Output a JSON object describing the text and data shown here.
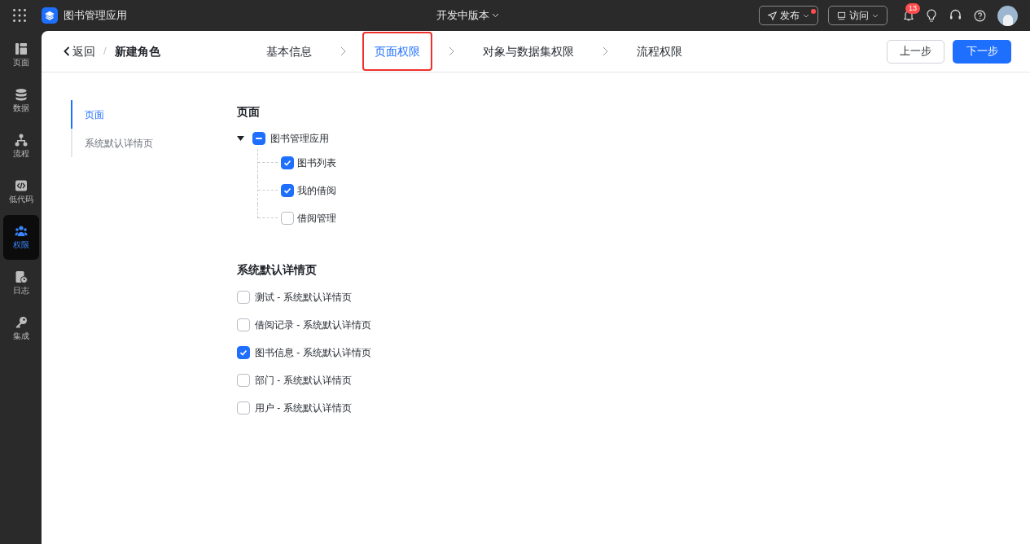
{
  "topbar": {
    "app_name": "图书管理应用",
    "version": "开发中版本",
    "publish": {
      "label": "发布",
      "dot": true
    },
    "visit": {
      "label": "访问"
    },
    "notifications": "13"
  },
  "rail": [
    {
      "label": "页面",
      "kind": "layout",
      "selected": false
    },
    {
      "label": "数据",
      "kind": "database",
      "selected": false
    },
    {
      "label": "流程",
      "kind": "flow",
      "selected": false
    },
    {
      "label": "低代码",
      "kind": "code",
      "selected": false
    },
    {
      "label": "权限",
      "kind": "users",
      "selected": true
    },
    {
      "label": "日志",
      "kind": "log",
      "selected": false
    },
    {
      "label": "集成",
      "kind": "key",
      "selected": false
    }
  ],
  "breadcrumb": {
    "back": "返回",
    "separator": "/",
    "current": "新建角色"
  },
  "steps": [
    {
      "label": "基本信息",
      "selected": false,
      "highlighted": false
    },
    {
      "label": "页面权限",
      "selected": true,
      "highlighted": true
    },
    {
      "label": "对象与数据集权限",
      "selected": false,
      "highlighted": false
    },
    {
      "label": "流程权限",
      "selected": false,
      "highlighted": false
    }
  ],
  "buttons": {
    "prev": "上一步",
    "next": "下一步"
  },
  "anchors": [
    {
      "label": "页面",
      "selected": true
    },
    {
      "label": "系统默认详情页",
      "selected": false
    }
  ],
  "pages_section": {
    "title": "页面",
    "tree": {
      "label": "图书管理应用",
      "expanded": true,
      "indeterminate": true,
      "children": [
        {
          "label": "图书列表",
          "checked": true
        },
        {
          "label": "我的借阅",
          "checked": true
        },
        {
          "label": "借阅管理",
          "checked": false
        }
      ]
    }
  },
  "detail_section": {
    "title": "系统默认详情页",
    "items": [
      {
        "label": "测试 - 系统默认详情页",
        "checked": false
      },
      {
        "label": "借阅记录 - 系统默认详情页",
        "checked": false
      },
      {
        "label": "图书信息 - 系统默认详情页",
        "checked": true
      },
      {
        "label": "部门 - 系统默认详情页",
        "checked": false
      },
      {
        "label": "用户 - 系统默认详情页",
        "checked": false
      }
    ]
  }
}
